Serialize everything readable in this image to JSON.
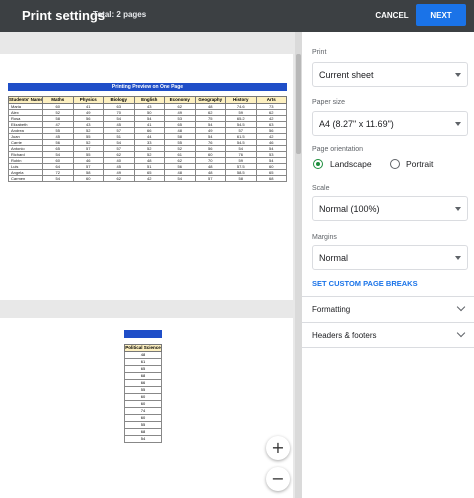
{
  "header": {
    "title": "Print settings",
    "total": "Total: 2 pages",
    "cancel_label": "CANCEL",
    "next_label": "NEXT"
  },
  "preview": {
    "page1": {
      "title": "Printing Preview on One Page",
      "columns": [
        "Students' Name",
        "Maths",
        "Physics",
        "Biology",
        "English",
        "Economy",
        "Geography",
        "History",
        "Arts"
      ],
      "rows": [
        [
          "Maria",
          "60",
          "41",
          "63",
          "43",
          "62",
          "48",
          "74.6",
          "73"
        ],
        [
          "Alex",
          "52",
          "49",
          "70",
          "50",
          "49",
          "62",
          "59",
          "62"
        ],
        [
          "Rosa",
          "58",
          "56",
          "54",
          "54",
          "53",
          "75",
          "65.2",
          "42"
        ],
        [
          "Elizabeth",
          "47",
          "43",
          "45",
          "41",
          "65",
          "54",
          "54.5",
          "63"
        ],
        [
          "Andrea",
          "55",
          "52",
          "57",
          "66",
          "48",
          "49",
          "57",
          "56"
        ],
        [
          "Juan",
          "45",
          "55",
          "51",
          "44",
          "58",
          "54",
          "61.5",
          "42"
        ],
        [
          "Carrie",
          "56",
          "52",
          "54",
          "33",
          "55",
          "76",
          "54.5",
          "46"
        ],
        [
          "Antonio",
          "65",
          "57",
          "57",
          "52",
          "52",
          "56",
          "54",
          "54"
        ],
        [
          "Richard",
          "54",
          "55",
          "62",
          "52",
          "61",
          "60",
          "76",
          "53"
        ],
        [
          "Robin",
          "60",
          "46",
          "40",
          "48",
          "62",
          "70",
          "59",
          "54"
        ],
        [
          "Luis",
          "64",
          "57",
          "45",
          "51",
          "56",
          "48",
          "57.5",
          "60"
        ],
        [
          "Angela",
          "72",
          "58",
          "49",
          "65",
          "48",
          "48",
          "58.5",
          "65"
        ],
        [
          "Carmen",
          "54",
          "60",
          "62",
          "42",
          "54",
          "57",
          "58",
          "68"
        ]
      ]
    },
    "page2": {
      "column": "Political Science",
      "values": [
        "48",
        "61",
        "65",
        "68",
        "66",
        "55",
        "60",
        "60",
        "74",
        "60",
        "55",
        "68",
        "54"
      ]
    },
    "zoom_in": "+",
    "zoom_out": "−"
  },
  "settings": {
    "print_label": "Print",
    "print_value": "Current sheet",
    "paper_label": "Paper size",
    "paper_value": "A4 (8.27\" x 11.69\")",
    "orientation_label": "Page orientation",
    "landscape": "Landscape",
    "portrait": "Portrait",
    "orientation_selected": "Landscape",
    "scale_label": "Scale",
    "scale_value": "Normal (100%)",
    "margins_label": "Margins",
    "margins_value": "Normal",
    "custom_breaks": "SET CUSTOM PAGE BREAKS",
    "formatting": "Formatting",
    "headers_footers": "Headers & footers"
  },
  "colors": {
    "topbar": "#3c4043",
    "accent": "#1a73e8",
    "sheet_header_blue": "#1f4ec8",
    "radio_green": "#1e8e3e"
  }
}
